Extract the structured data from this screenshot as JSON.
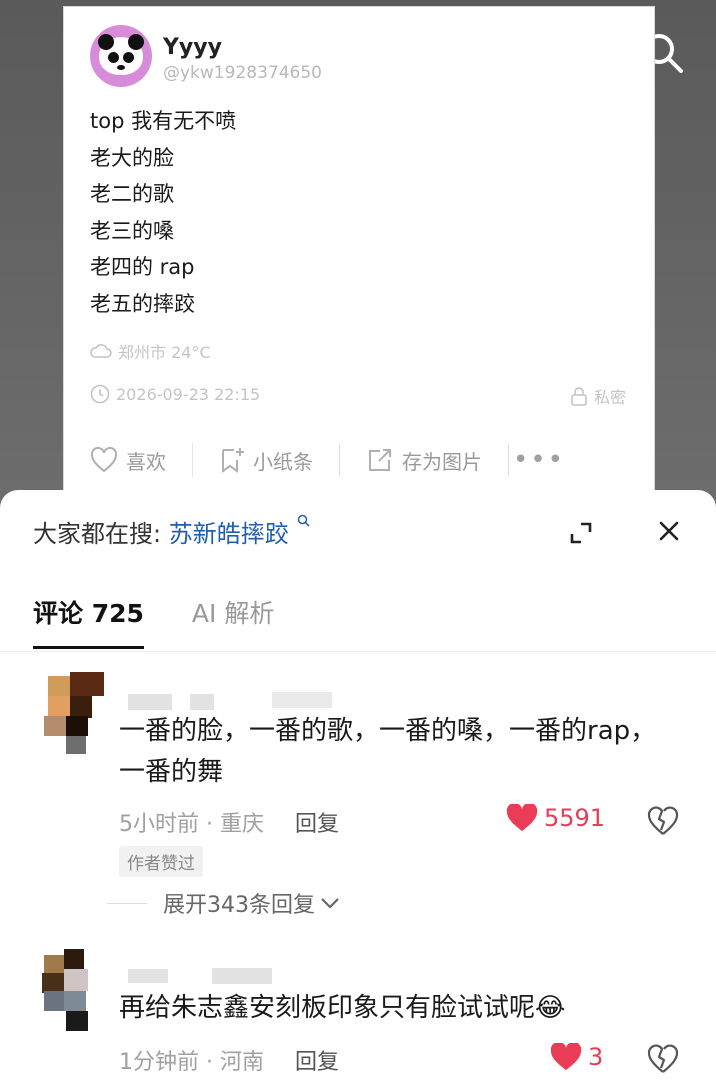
{
  "post": {
    "username": "Yyyy",
    "handle": "@ykw1928374650",
    "lines": [
      "top 我有无不喷",
      "老大的脸",
      "老二的歌",
      "老三的嗓",
      "老四的 rap",
      "老五的摔跤"
    ],
    "location": "郑州市 24°C",
    "timestamp": "2026-09-23 22:15",
    "privacy": "私密",
    "actions": {
      "like": "喜欢",
      "note": "小纸条",
      "save_image": "存为图片",
      "more": "•••"
    }
  },
  "sheet": {
    "search_prefix": "大家都在搜:",
    "search_keyword": "苏新皓摔跤",
    "tabs": [
      {
        "label": "评论 725",
        "active": true
      },
      {
        "label": "AI 解析",
        "active": false
      }
    ]
  },
  "comments": [
    {
      "text": "一番的脸，一番的歌，一番的嗓，一番的rap，一番的舞",
      "time": "5小时前",
      "location": "重庆",
      "reply_label": "回复",
      "likes": "5591",
      "badge": "作者赞过",
      "expand_label": "展开343条回复"
    },
    {
      "text": "再给朱志鑫安刻板印象只有脸试试呢😂",
      "time": "1分钟前",
      "location": "河南",
      "reply_label": "回复",
      "likes": "3"
    }
  ],
  "colors": {
    "accent_like": "#ea3b57",
    "keyword": "#1f5fb0",
    "avatar_bg": "#d88bd8"
  }
}
